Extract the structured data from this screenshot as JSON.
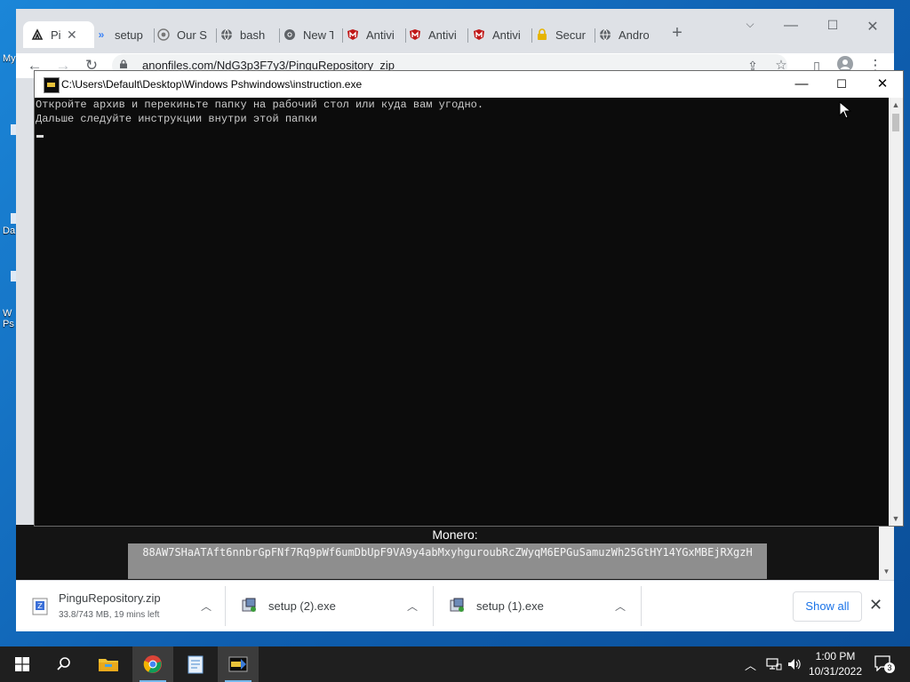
{
  "browser": {
    "tabs": [
      {
        "title": "Pi",
        "icon": "file-hosting-icon"
      },
      {
        "title": "setup",
        "icon": "vscode-icon"
      },
      {
        "title": "Our S",
        "icon": "globe-icon"
      },
      {
        "title": "bash",
        "icon": "globe-icon"
      },
      {
        "title": "New T",
        "icon": "chrome-icon"
      },
      {
        "title": "Antivi",
        "icon": "mcafee-icon"
      },
      {
        "title": "Antivi",
        "icon": "mcafee-icon"
      },
      {
        "title": "Antivi",
        "icon": "mcafee-icon"
      },
      {
        "title": "Secur",
        "icon": "lock-icon"
      },
      {
        "title": "Andro",
        "icon": "globe-icon"
      }
    ],
    "url": "anonfiles.com/NdG3p3F7y3/PinguRepository_zip"
  },
  "console": {
    "title": "C:\\Users\\Default\\Desktop\\Windows Pshwindows\\instruction.exe",
    "lines": [
      "Откройте архив и перекиньте папку на рабочий стол или куда вам угодно.",
      "Дальше следуйте инструкции внутри этой папки"
    ]
  },
  "page": {
    "monero_label": "Monero:",
    "monero_address": "88AW7SHaATAft6nnbrGpFNf7Rq9pWf6umDbUpF9VA9y4abMxyhguroubRcZWyqM6EPGuSamuzWh25GtHY14YGxMBEjRXgzH"
  },
  "downloads": {
    "items": [
      {
        "name": "PinguRepository.zip",
        "status": "33.8/743 MB, 19 mins left",
        "icon": "zip-file-icon"
      },
      {
        "name": "setup (2).exe",
        "status": "",
        "icon": "installer-icon"
      },
      {
        "name": "setup (1).exe",
        "status": "",
        "icon": "installer-icon"
      }
    ],
    "show_all_label": "Show all"
  },
  "desktop": {
    "icons": [
      {
        "label": "My"
      },
      {
        "label": ""
      },
      {
        "label": "Da"
      },
      {
        "label": "W\nPs"
      }
    ]
  },
  "taskbar": {
    "time": "1:00 PM",
    "date": "10/31/2022",
    "notification_count": "3"
  },
  "colors": {
    "desktop_accent": "#1a72c9",
    "console_bg": "#0c0c0c",
    "link_blue": "#1a73e8",
    "mcafee_red": "#c01818"
  }
}
